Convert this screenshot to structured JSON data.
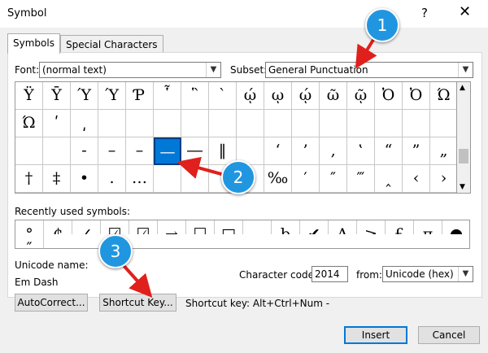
{
  "window": {
    "title": "Symbol",
    "help_glyph": "?",
    "close_glyph": "✕"
  },
  "tabs": [
    {
      "label": "Symbols"
    },
    {
      "label": "Special Characters"
    }
  ],
  "font": {
    "label": "Font:",
    "value": "(normal text)"
  },
  "subset": {
    "label": "Subset:",
    "value": "General Punctuation"
  },
  "grid": {
    "rows": [
      [
        "Ÿ",
        "Ȳ",
        "Ύ",
        "Ύ",
        "Ƥ",
        "῟",
        "῝",
        "`",
        "ῴ",
        "ῳ",
        "ῴ",
        "ῶ",
        "ῷ",
        "Ὀ",
        "Ὀ",
        "Ώ"
      ],
      [
        "Ώ",
        "ʹ",
        "͵",
        "",
        "",
        "",
        "",
        "",
        "",
        "",
        "",
        "",
        "",
        "",
        "",
        ""
      ],
      [
        "",
        "",
        "‐",
        "–",
        "–",
        "—",
        "―",
        "‖",
        "",
        "‘",
        "’",
        "‚",
        "‛",
        "“",
        "”",
        "„"
      ],
      [
        "†",
        "‡",
        "•",
        "․",
        "…",
        "",
        "",
        "",
        "",
        "‰",
        "′",
        "″",
        "‴",
        "‸",
        "‹",
        "›"
      ]
    ]
  },
  "recent": {
    "label": "Recently used symbols:",
    "symbols": [
      "°",
      "₵",
      "✓",
      "☑",
      "☑",
      "→",
      "☐",
      "□",
      "",
      "þ",
      "✔",
      "Δ",
      "≥",
      "£",
      "π",
      "●",
      "″"
    ]
  },
  "unicode": {
    "label": "Unicode name:",
    "name": "Em Dash"
  },
  "char_code": {
    "label": "Character code:",
    "value": "2014"
  },
  "from": {
    "label": "from:",
    "value": "Unicode (hex)"
  },
  "buttons": {
    "autocorrect": "AutoCorrect...",
    "shortcut_key": "Shortcut Key...",
    "insert": "Insert",
    "cancel": "Cancel"
  },
  "shortcut": {
    "text": "Shortcut key: Alt+Ctrl+Num -"
  },
  "annotations": [
    "1",
    "2",
    "3"
  ],
  "colors": {
    "accent": "#0078d7",
    "badge": "#2196e0",
    "arrow": "#e0201c"
  }
}
